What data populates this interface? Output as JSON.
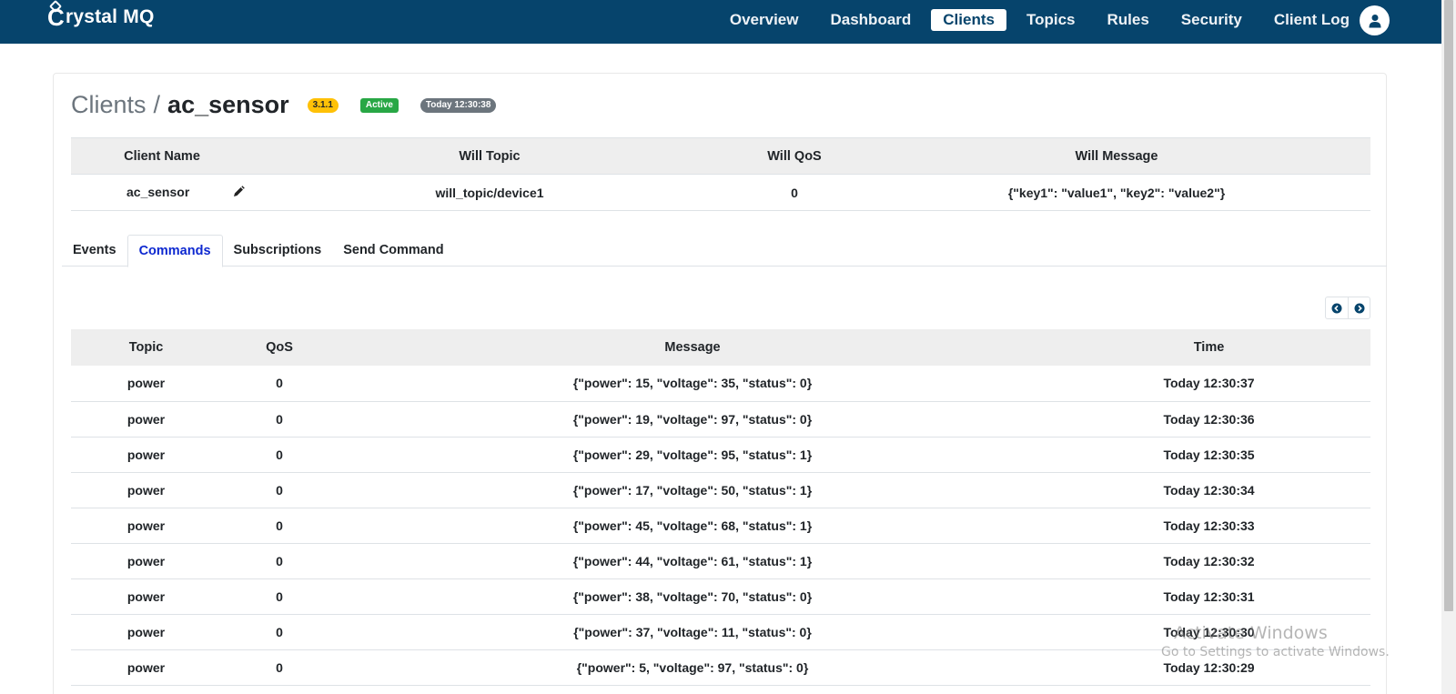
{
  "brand": {
    "letter": "C",
    "text": "rystal MQ"
  },
  "nav": {
    "items": [
      {
        "label": "Overview",
        "active": false
      },
      {
        "label": "Dashboard",
        "active": false
      },
      {
        "label": "Clients",
        "active": true
      },
      {
        "label": "Topics",
        "active": false
      },
      {
        "label": "Rules",
        "active": false
      },
      {
        "label": "Security",
        "active": false
      },
      {
        "label": "Client Log",
        "active": false
      }
    ],
    "user_icon": "user-icon"
  },
  "page": {
    "breadcrumb_root": "Clients",
    "separator": "/",
    "client_name": "ac_sensor",
    "badges": {
      "version": "3.1.1",
      "status": "Active",
      "time": "Today 12:30:38"
    }
  },
  "client_info": {
    "headers": [
      "Client Name",
      "Will Topic",
      "Will QoS",
      "Will Message"
    ],
    "row": {
      "client_name": "ac_sensor",
      "will_topic": "will_topic/device1",
      "will_qos": "0",
      "will_message": "{\"key1\": \"value1\", \"key2\": \"value2\"}"
    }
  },
  "tabs": [
    {
      "label": "Events",
      "active": false
    },
    {
      "label": "Commands",
      "active": true
    },
    {
      "label": "Subscriptions",
      "active": false
    },
    {
      "label": "Send Command",
      "active": false
    }
  ],
  "commands": {
    "headers": [
      "Topic",
      "QoS",
      "Message",
      "Time"
    ],
    "rows": [
      {
        "topic": "power",
        "qos": "0",
        "message": "{\"power\": 15, \"voltage\": 35, \"status\": 0}",
        "time": "Today 12:30:37"
      },
      {
        "topic": "power",
        "qos": "0",
        "message": "{\"power\": 19, \"voltage\": 97, \"status\": 0}",
        "time": "Today 12:30:36"
      },
      {
        "topic": "power",
        "qos": "0",
        "message": "{\"power\": 29, \"voltage\": 95, \"status\": 1}",
        "time": "Today 12:30:35"
      },
      {
        "topic": "power",
        "qos": "0",
        "message": "{\"power\": 17, \"voltage\": 50, \"status\": 1}",
        "time": "Today 12:30:34"
      },
      {
        "topic": "power",
        "qos": "0",
        "message": "{\"power\": 45, \"voltage\": 68, \"status\": 1}",
        "time": "Today 12:30:33"
      },
      {
        "topic": "power",
        "qos": "0",
        "message": "{\"power\": 44, \"voltage\": 61, \"status\": 1}",
        "time": "Today 12:30:32"
      },
      {
        "topic": "power",
        "qos": "0",
        "message": "{\"power\": 38, \"voltage\": 70, \"status\": 0}",
        "time": "Today 12:30:31"
      },
      {
        "topic": "power",
        "qos": "0",
        "message": "{\"power\": 37, \"voltage\": 11, \"status\": 0}",
        "time": "Today 12:30:30"
      },
      {
        "topic": "power",
        "qos": "0",
        "message": "{\"power\": 5, \"voltage\": 97, \"status\": 0}",
        "time": "Today 12:30:29"
      }
    ]
  },
  "watermark": {
    "line1": "Activate Windows",
    "line2": "Go to Settings to activate Windows."
  },
  "colors": {
    "navbar": "#06446c",
    "active_tab": "#0d28d0",
    "badge_version": "#ffc107",
    "badge_active": "#28a745",
    "badge_time": "#6c757d"
  }
}
